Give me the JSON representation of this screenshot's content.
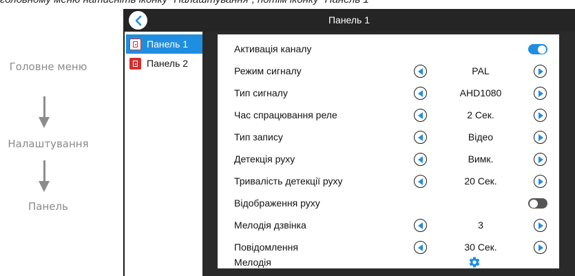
{
  "caption": "головному меню натисніть іконку “Налаштування”, потім іконку “Панель 1”",
  "flow": {
    "steps": [
      "Головне меню",
      "Налаштування",
      "Панель"
    ]
  },
  "screen": {
    "title": "Панель 1",
    "sidebar": {
      "items": [
        {
          "label": "Панель 1",
          "active": true
        },
        {
          "label": "Панель 2",
          "active": false
        }
      ]
    },
    "settings": [
      {
        "label": "Активація каналу",
        "type": "toggle",
        "state": "on"
      },
      {
        "label": "Режим сигналу",
        "type": "selector",
        "value": "PAL"
      },
      {
        "label": "Тип сигналу",
        "type": "selector",
        "value": "AHD1080"
      },
      {
        "label": "Час спрацювання реле",
        "type": "selector",
        "value": "2 Сек."
      },
      {
        "label": "Тип запису",
        "type": "selector",
        "value": "Відео"
      },
      {
        "label": "Детекція руху",
        "type": "selector",
        "value": "Вимк."
      },
      {
        "label": "Тривалість детекції руху",
        "type": "selector",
        "value": "20 Сек."
      },
      {
        "label": "Відображення руху",
        "type": "toggle",
        "state": "off"
      },
      {
        "label": "Мелодія дзвінка",
        "type": "selector",
        "value": "3"
      },
      {
        "label": "Повідомлення",
        "type": "selector",
        "value": "30 Сек."
      },
      {
        "label": "Мелодія",
        "type": "gear",
        "icon": "gear-icon"
      }
    ]
  },
  "colors": {
    "accent": "#1f8ee0",
    "screen_bg": "#2a2a2a",
    "panel_icon": "#d32f2f"
  }
}
